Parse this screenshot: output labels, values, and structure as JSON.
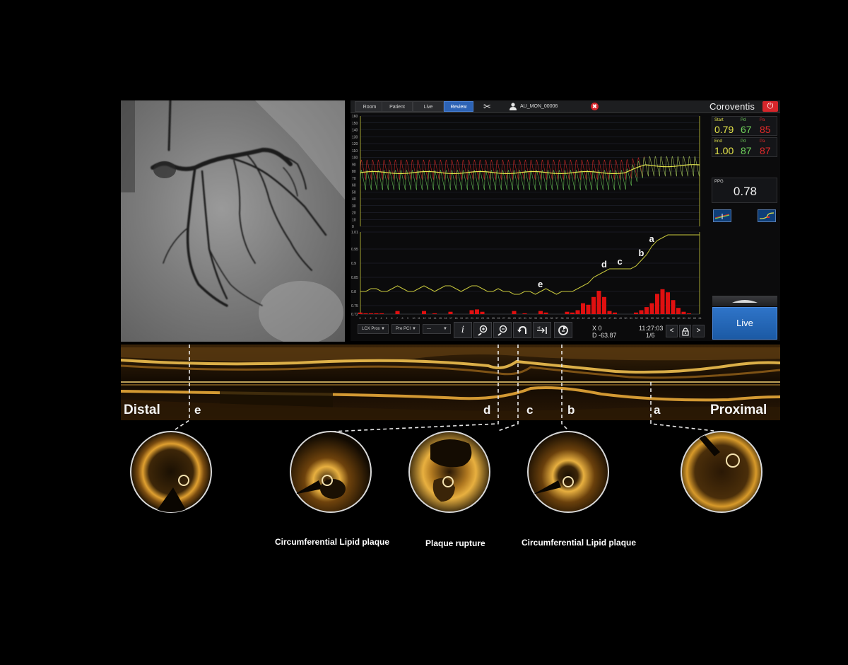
{
  "topbar": {
    "tabs": [
      {
        "label": "Room",
        "active": false
      },
      {
        "label": "Patient",
        "active": false
      },
      {
        "label": "Live",
        "active": false
      },
      {
        "label": "Review",
        "active": true
      }
    ],
    "patient_id": "AU_MON_00006",
    "brand": "Coroventis",
    "close_glyph": "✖",
    "power_glyph": "⏻",
    "tools_glyph": "✂"
  },
  "readings": {
    "start": {
      "label": "Start",
      "ratio": "0.79",
      "pd_label": "Pd",
      "pd": "67",
      "pa_label": "Pa",
      "pa": "85"
    },
    "end": {
      "label": "End",
      "ratio": "1.00",
      "pd_label": "Pd",
      "pd": "87",
      "pa_label": "Pa",
      "pa": "87"
    },
    "ppg": {
      "label": "PPG",
      "value": "0.78"
    }
  },
  "live_button": "Live",
  "toolbar": {
    "vessel": "LCX Prox",
    "phase": "Pre PCI",
    "third": "---",
    "info_glyph": "i",
    "x_readout": "X 0",
    "d_readout": "D -63.87",
    "time": "11:27:03",
    "frame": "1/6",
    "prev_glyph": "<",
    "next_glyph": ">"
  },
  "colors": {
    "pd_green": "#6fd15a",
    "pa_red": "#e02a2a",
    "ratio_yellow": "#e6e64a",
    "pullback_line": "#c8c83c",
    "gradient_bars": "#e01010",
    "oct_gold": "#d89a2a",
    "accent_blue": "#2d63b5"
  },
  "chart_data": [
    {
      "type": "line",
      "name": "pressure-tracings",
      "y_ticks": [
        "160",
        "150",
        "140",
        "130",
        "120",
        "110",
        "100",
        "90",
        "80",
        "70",
        "60",
        "50",
        "40",
        "30",
        "20",
        "10",
        "0"
      ],
      "ylim": [
        0,
        160
      ],
      "series": [
        {
          "name": "Pa",
          "color": "#e02a2a",
          "mean_start": 82,
          "mean_end": 87,
          "pulse_amplitude": 30
        },
        {
          "name": "Pd",
          "color": "#6fd15a",
          "mean_start": 67,
          "mean_end": 87,
          "pulse_amplitude": 30
        },
        {
          "name": "Pd/Pa",
          "color": "#e6e64a",
          "mean_start": 78,
          "mean_end": 88
        }
      ]
    },
    {
      "type": "line",
      "name": "pullback-ratio",
      "y_ticks": [
        "1.01",
        "0.95",
        "0.9",
        "0.85",
        "0.8",
        "0.75",
        "0.72"
      ],
      "ylim": [
        0.72,
        1.01
      ],
      "x_ticks": [
        "0",
        "1",
        "2",
        "3",
        "4",
        "5",
        "6",
        "7",
        "8",
        "9",
        "10",
        "11",
        "12",
        "13",
        "14",
        "15",
        "16",
        "17",
        "18",
        "19",
        "20",
        "21",
        "22",
        "23",
        "24",
        "25",
        "26",
        "27",
        "28",
        "29",
        "30",
        "31",
        "32",
        "33",
        "34",
        "35",
        "36",
        "37",
        "38",
        "39",
        "40",
        "41",
        "42",
        "43",
        "44",
        "45",
        "46",
        "47",
        "48",
        "49",
        "50",
        "51",
        "52",
        "53",
        "54",
        "55",
        "56",
        "57",
        "58",
        "59",
        "60",
        "61",
        "62",
        "63",
        "64"
      ],
      "x": [
        0,
        1,
        2,
        3,
        4,
        5,
        6,
        7,
        8,
        9,
        10,
        11,
        12,
        13,
        14,
        15,
        16,
        17,
        18,
        19,
        20,
        21,
        22,
        23,
        24,
        25,
        26,
        27,
        28,
        29,
        30,
        31,
        32,
        33,
        34,
        35,
        36,
        37,
        38,
        39,
        40,
        41,
        42,
        43,
        44,
        45,
        46,
        47,
        48,
        49,
        50,
        51,
        52,
        53,
        54,
        55,
        56,
        57,
        58,
        59,
        60,
        61,
        62,
        63,
        64
      ],
      "values": [
        0.8,
        0.8,
        0.81,
        0.81,
        0.8,
        0.8,
        0.81,
        0.82,
        0.81,
        0.8,
        0.8,
        0.81,
        0.82,
        0.81,
        0.8,
        0.81,
        0.82,
        0.82,
        0.81,
        0.8,
        0.81,
        0.82,
        0.82,
        0.81,
        0.8,
        0.8,
        0.81,
        0.8,
        0.8,
        0.79,
        0.79,
        0.8,
        0.8,
        0.79,
        0.8,
        0.81,
        0.8,
        0.79,
        0.8,
        0.8,
        0.8,
        0.81,
        0.82,
        0.83,
        0.85,
        0.86,
        0.87,
        0.88,
        0.88,
        0.88,
        0.88,
        0.88,
        0.89,
        0.91,
        0.93,
        0.96,
        0.98,
        0.99,
        1.0,
        1.0,
        1.0,
        1.0,
        1.0,
        1.0,
        1.0
      ],
      "gradient_bars": [
        0.2,
        0.1,
        0.1,
        0.1,
        0.1,
        0,
        0,
        0.4,
        0,
        0,
        0,
        0,
        0.4,
        0,
        0.1,
        0,
        0,
        0.3,
        0,
        0,
        0,
        0.5,
        0.6,
        0.3,
        0,
        0,
        0,
        0,
        0,
        0.4,
        0,
        0.1,
        0,
        0,
        0.4,
        0.2,
        0,
        0,
        0,
        0.3,
        0.2,
        0.5,
        1.4,
        1.2,
        2.2,
        3.0,
        2.2,
        0.4,
        0.2,
        0,
        0,
        0,
        0.2,
        0.5,
        0.9,
        1.4,
        2.6,
        3.2,
        2.8,
        1.8,
        0.8,
        0.3,
        0.1,
        0,
        0
      ],
      "annotations": [
        {
          "label": "a",
          "x": 55
        },
        {
          "label": "b",
          "x": 53
        },
        {
          "label": "c",
          "x": 49
        },
        {
          "label": "d",
          "x": 46
        },
        {
          "label": "e",
          "x": 34
        }
      ]
    }
  ],
  "oct": {
    "distal": "Distal",
    "proximal": "Proximal",
    "segments": [
      "e",
      "d",
      "c",
      "b",
      "a"
    ]
  },
  "cross_sections": [
    {
      "caption": ""
    },
    {
      "caption": "Circumferential Lipid plaque"
    },
    {
      "caption": "Plaque rupture"
    },
    {
      "caption": "Circumferential Lipid plaque"
    },
    {
      "caption": ""
    }
  ]
}
